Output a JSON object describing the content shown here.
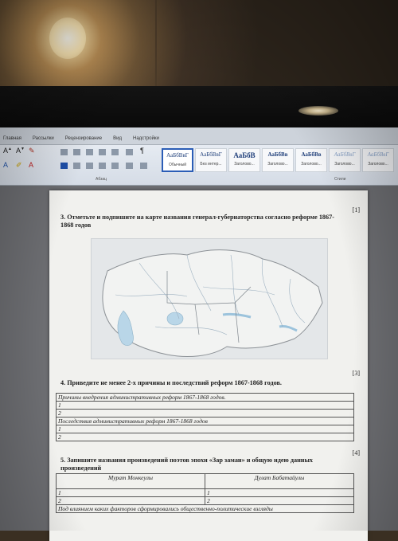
{
  "ribbon": {
    "tabs": [
      "Главная",
      "Рассылки",
      "Рецензирование",
      "Вид",
      "Надстройки"
    ],
    "styles": [
      {
        "sample": "АаБбВвГ",
        "name": "Обычный"
      },
      {
        "sample": "АаБбВвГ",
        "name": "Без интер..."
      },
      {
        "sample": "АаБбВ",
        "name": "Заголово..."
      },
      {
        "sample": "АаБбВв",
        "name": "Заголово..."
      },
      {
        "sample": "АаБбВв",
        "name": "Заголово..."
      },
      {
        "sample": "АаБбВвГ",
        "name": "Заголово..."
      },
      {
        "sample": "АаБбВвГ",
        "name": "Заголово..."
      }
    ],
    "paragraph_group": "Абзац",
    "styles_group": "Стили"
  },
  "document": {
    "q3": {
      "mark": "[1]",
      "line1": "3. Отметьте и подпишите на карте названия генерал-губернаторства согласно реформе 1867-",
      "line2": "1868 годов"
    },
    "q4": {
      "mark": "[3]",
      "title": "4. Приведите не менее 2-х причины и последствий реформ 1867-1868 годов.",
      "rows": [
        "Причины внедрения административных реформ 1867-1868 годов.",
        "1",
        "2",
        "Последствия административных реформ 1867-1868 годов",
        "1",
        "2"
      ]
    },
    "q5": {
      "mark": "[4]",
      "line1": "5. Запишите названия произведений поэтов эпохи «Зар заман» и общую идею данных",
      "line2": "произведений",
      "headers": [
        "Мурат Монкеулы",
        "Дулат Бабатайулы"
      ],
      "rows": [
        [
          "1",
          "1"
        ],
        [
          "2",
          "2"
        ]
      ],
      "footer": "Под влиянием каких факторов сформировались общественно-политические взгляды"
    }
  },
  "colors": {
    "ribbon_bg": "#dfe5ec",
    "selected_style_border": "#2b5db6",
    "page_bg": "#f1f1ee",
    "map_water": "#b9d6e8"
  }
}
